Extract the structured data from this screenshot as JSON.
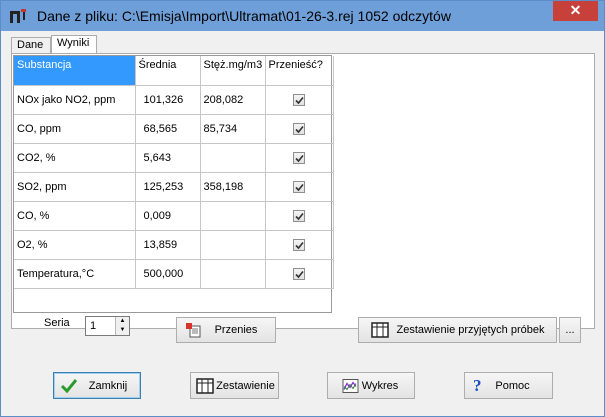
{
  "window": {
    "title": "Dane z pliku: C:\\Emisja\\Import\\Ultramat\\01-26-3.rej  1052 odczytów",
    "close_glyph": "✕"
  },
  "tabs": [
    {
      "label": "Dane",
      "active": false
    },
    {
      "label": "Wyniki",
      "active": true
    }
  ],
  "table": {
    "headers": [
      "Substancja",
      "Średnia",
      "Stęż.mg/m3",
      "Przenieść?"
    ],
    "rows": [
      {
        "substance": "NOx jako NO2, ppm",
        "mean": "101,326",
        "conc": "208,082",
        "transfer": true
      },
      {
        "substance": "CO, ppm",
        "mean": "68,565",
        "conc": "85,734",
        "transfer": true
      },
      {
        "substance": "CO2, %",
        "mean": "5,643",
        "conc": "",
        "transfer": true
      },
      {
        "substance": "SO2, ppm",
        "mean": "125,253",
        "conc": "358,198",
        "transfer": true
      },
      {
        "substance": "CO, %",
        "mean": "0,009",
        "conc": "",
        "transfer": true
      },
      {
        "substance": "O2, %",
        "mean": "13,859",
        "conc": "",
        "transfer": true
      },
      {
        "substance": "Temperatura,°C",
        "mean": "500,000",
        "conc": "",
        "transfer": true
      }
    ]
  },
  "seria": {
    "label": "Seria",
    "value": "1"
  },
  "buttons": {
    "przenies": "Przenies",
    "zestawienie_probek": "Zestawienie przyjętych próbek",
    "more": "...",
    "zamknij": "Zamknij",
    "zestawienie": "Zestawienie",
    "wykres": "Wykres",
    "pomoc": "Pomoc"
  },
  "colors": {
    "selection": "#3399ff",
    "titlebar": "#6e9fd8",
    "close": "#c7403a"
  },
  "icons": [
    "app-icon",
    "import-icon",
    "table-icon",
    "checkmark-icon",
    "chart-icon",
    "help-icon",
    "close-icon"
  ]
}
